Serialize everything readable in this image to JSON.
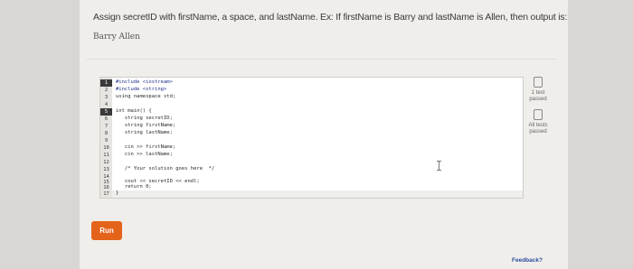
{
  "prompt": "Assign secretID with firstName, a space, and lastName. Ex: If firstName is Barry and lastName is Allen, then output is:",
  "sample_output": "Barry Allen",
  "editor": {
    "line_numbers": [
      "1",
      "2",
      "3",
      "4",
      "5",
      "6",
      "7",
      "8",
      "9",
      "10",
      "11",
      "12",
      "13",
      "14",
      "15",
      "16",
      "17"
    ],
    "lines": [
      "#include <iostream>",
      "#include <string>",
      "using namespace std;",
      "",
      "int main() {",
      "   string secretID;",
      "   string firstName;",
      "   string lastName;",
      "",
      "   cin >> firstName;",
      "   cin >> lastName;",
      "",
      "   /* Your solution goes here  */",
      "",
      "   cout << secretID << endl;",
      "   return 0;",
      "}"
    ]
  },
  "run_button": "Run",
  "tests": [
    {
      "label_line1": "1 test",
      "label_line2": "passed"
    },
    {
      "label_line1": "All tests",
      "label_line2": "passed"
    }
  ],
  "feedback_link": "Feedback?"
}
